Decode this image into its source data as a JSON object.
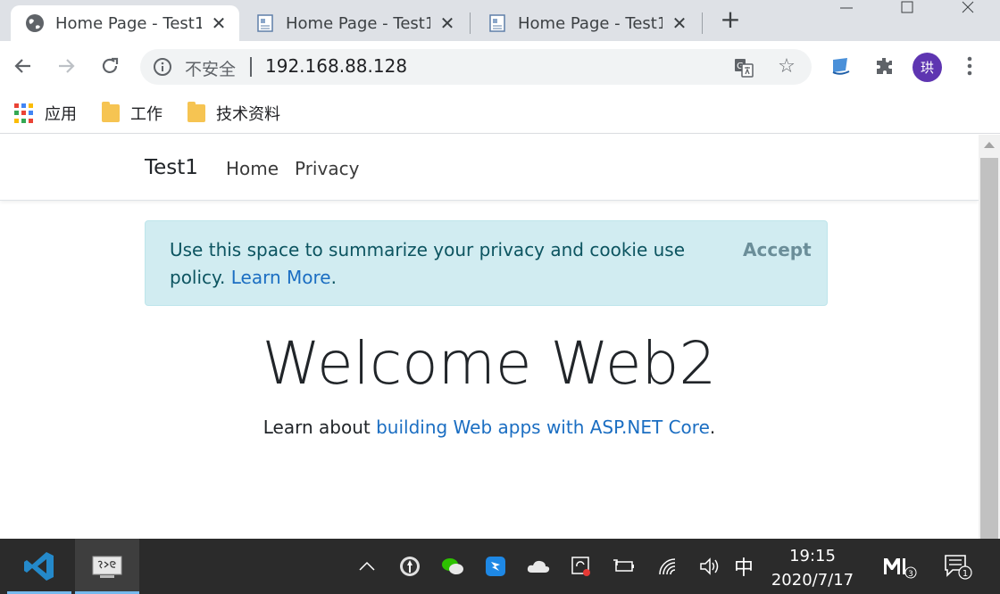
{
  "browser": {
    "tabs": [
      {
        "title": "Home Page - Test1",
        "active": true,
        "favicon": "globe-icon"
      },
      {
        "title": "Home Page - Test1",
        "active": false,
        "favicon": "page-icon"
      },
      {
        "title": "Home Page - Test1",
        "active": false,
        "favicon": "page-icon"
      }
    ],
    "new_tab_label": "+",
    "address": {
      "security_label": "不安全",
      "url": "192.168.88.128"
    },
    "profile_initial": "珙",
    "bookmarks": [
      {
        "label": "应用",
        "icon": "apps-grid-icon"
      },
      {
        "label": "工作",
        "icon": "folder-icon"
      },
      {
        "label": "技术资料",
        "icon": "folder-icon"
      }
    ],
    "accent_color": "#1b6ec2"
  },
  "site": {
    "brand": "Test1",
    "nav": [
      "Home",
      "Privacy"
    ],
    "cookie_alert": {
      "text": "Use this space to summarize your privacy and cookie use policy.",
      "link": "Learn More",
      "after_link": ".",
      "accept_label": "Accept"
    },
    "heading": "Welcome Web2",
    "learn_prefix": "Learn about",
    "learn_link": "building Web apps with ASP.NET Core",
    "learn_suffix": "."
  },
  "taskbar": {
    "ime": "中",
    "time": "19:15",
    "date": "2020/7/17",
    "notification_count": "1",
    "app_badge_count": "3"
  }
}
